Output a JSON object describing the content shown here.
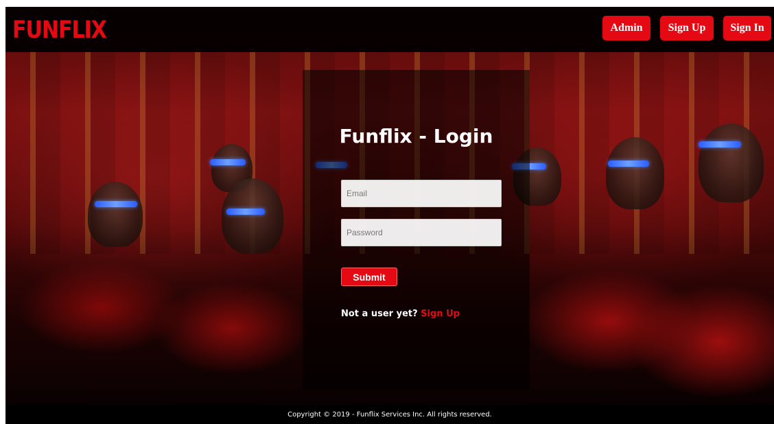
{
  "brand": {
    "logo": "FUNFLIX",
    "accent": "#e50914"
  },
  "nav": {
    "admin": "Admin",
    "signup": "Sign Up",
    "signin": "Sign In"
  },
  "login": {
    "title": "Funflix - Login",
    "email_placeholder": "Email",
    "password_placeholder": "Password",
    "submit": "Submit",
    "prompt": "Not a user yet?",
    "prompt_link": "Sign Up"
  },
  "footer": {
    "copyright": "Copyright © 2019 - Funflix Services Inc. All rights reserved."
  }
}
